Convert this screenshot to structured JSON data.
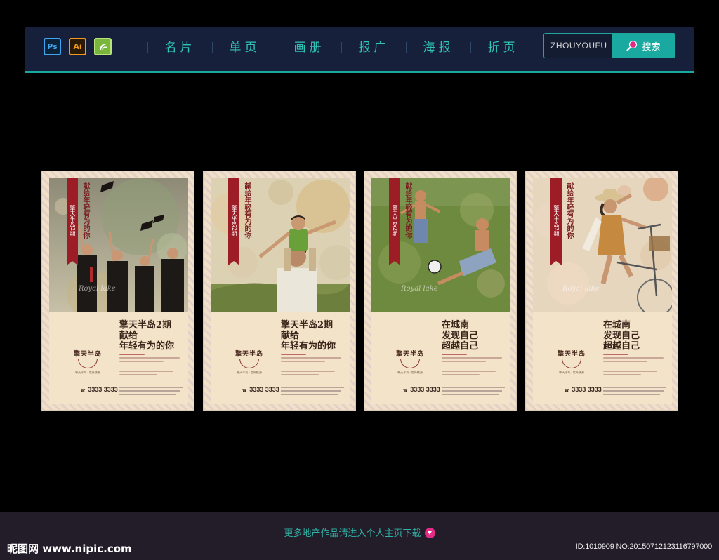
{
  "apps": [
    {
      "name": "photoshop-icon",
      "label": "Ps"
    },
    {
      "name": "illustrator-icon",
      "label": "Ai"
    },
    {
      "name": "coreldraw-icon",
      "label": ""
    }
  ],
  "nav": {
    "items": [
      "名片",
      "单页",
      "画册",
      "报广",
      "海报",
      "折页"
    ]
  },
  "search": {
    "value": "ZHOUYOUFU",
    "button_label": "搜索"
  },
  "posters": [
    {
      "ribbon": "擎天半岛2期",
      "tagline": "献给年轻有为的你",
      "script": "Royal lake",
      "headline": [
        "擎天半岛2期",
        "献给",
        "年轻有为的你"
      ],
      "logo": "擎天半岛",
      "logo_sub": "擎天半岛 · 世外桃源",
      "phone": "3333 3333"
    },
    {
      "ribbon": "擎天半岛2期",
      "tagline": "献给年轻有为的你",
      "script": "",
      "headline": [
        "擎天半岛2期",
        "献给",
        "年轻有为的你"
      ],
      "logo": "擎天半岛",
      "logo_sub": "擎天半岛 · 世外桃源",
      "phone": "3333 3333"
    },
    {
      "ribbon": "擎天半岛2期",
      "tagline": "献给年轻有为的你",
      "script": "Royal lake",
      "headline": [
        "在城南",
        "发现自己",
        "超越自己"
      ],
      "logo": "擎天半岛",
      "logo_sub": "擎天半岛 · 世外桃源",
      "phone": "3333 3333"
    },
    {
      "ribbon": "擎天半岛2期",
      "tagline": "献给年轻有为的你",
      "script": "Royal lake",
      "headline": [
        "在城南",
        "发现自己",
        "超越自己"
      ],
      "logo": "擎天半岛",
      "logo_sub": "擎天半岛 · 世外桃源",
      "phone": "3333 3333"
    }
  ],
  "footer": {
    "more_text": "更多地产作品请进入个人主页下载",
    "watermark": "昵图网 www.nipic.com",
    "id_text": "ID:1010909 NO:20150712123116797000"
  }
}
